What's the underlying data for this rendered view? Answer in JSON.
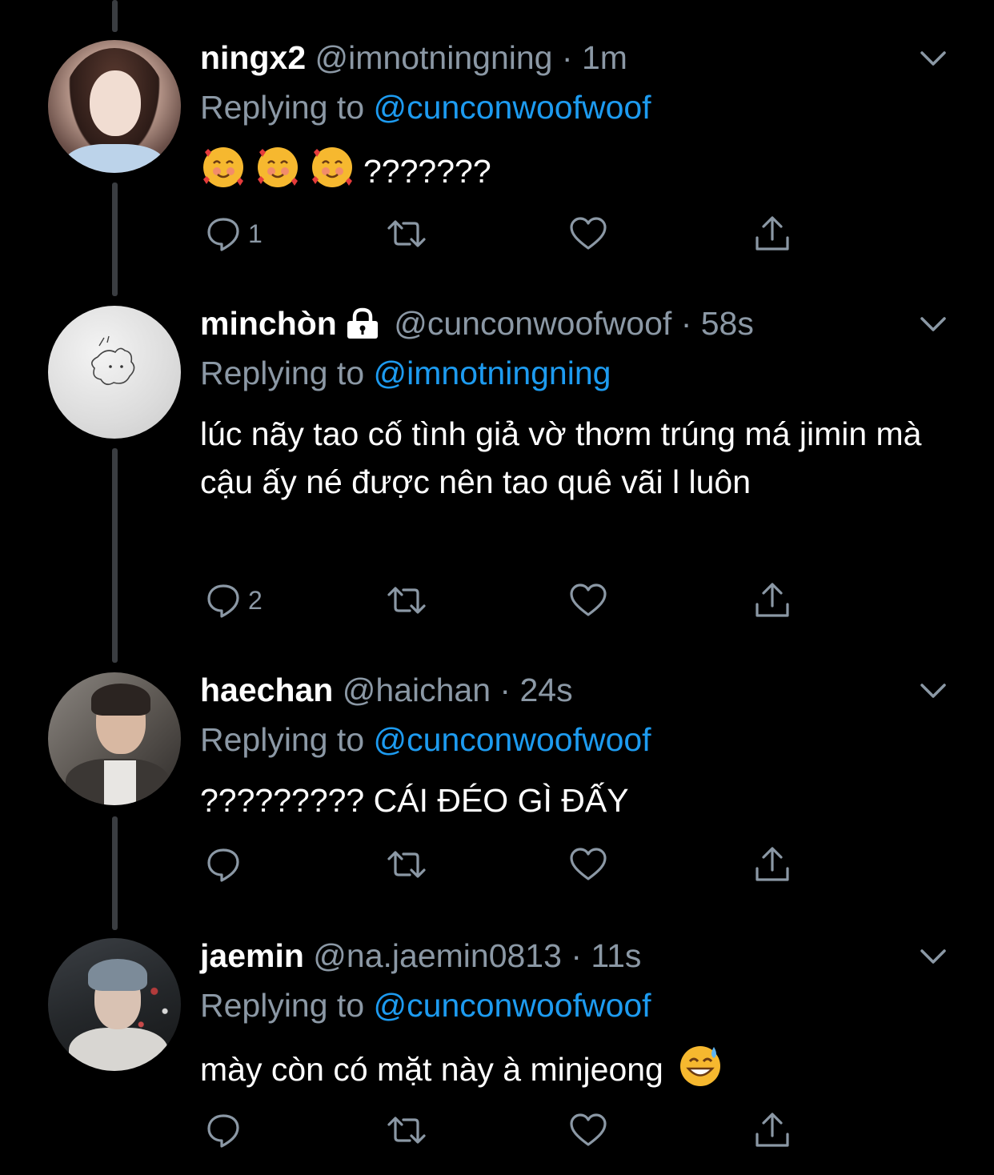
{
  "colors": {
    "background": "#000000",
    "text": "#ffffff",
    "secondary": "#8b98a5",
    "mention": "#1d9bf0",
    "thread_line": "#3a3d41"
  },
  "replying_prefix": "Replying to",
  "tweets": [
    {
      "display_name": "ningx2",
      "handle": "@imnotningning",
      "dot": "·",
      "time": "1m",
      "replying_to": "@cunconwoofwoof",
      "emoji": [
        "smiling-face-with-hearts",
        "smiling-face-with-hearts",
        "smiling-face-with-hearts"
      ],
      "text": "???????",
      "reply_count": "1"
    },
    {
      "display_name": "minchòn",
      "locked": true,
      "handle": "@cunconwoofwoof",
      "dot": "·",
      "time": "58s",
      "replying_to": "@imnotningning",
      "text": "lúc nãy tao cố tình giả vờ thơm trúng má jimin mà cậu ấy né được nên tao quê vãi l luôn",
      "reply_count": "2"
    },
    {
      "display_name": "haechan",
      "handle": "@haichan",
      "dot": "·",
      "time": "24s",
      "replying_to": "@cunconwoofwoof",
      "text": "????????? CÁI ĐÉO GÌ ĐẤY",
      "reply_count": ""
    },
    {
      "display_name": "jaemin",
      "handle": "@na.jaemin0813",
      "dot": "·",
      "time": "11s",
      "replying_to": "@cunconwoofwoof",
      "text": "mày còn có mặt này à minjeong",
      "trailing_emoji": "grinning-face-with-sweat",
      "reply_count": ""
    }
  ]
}
